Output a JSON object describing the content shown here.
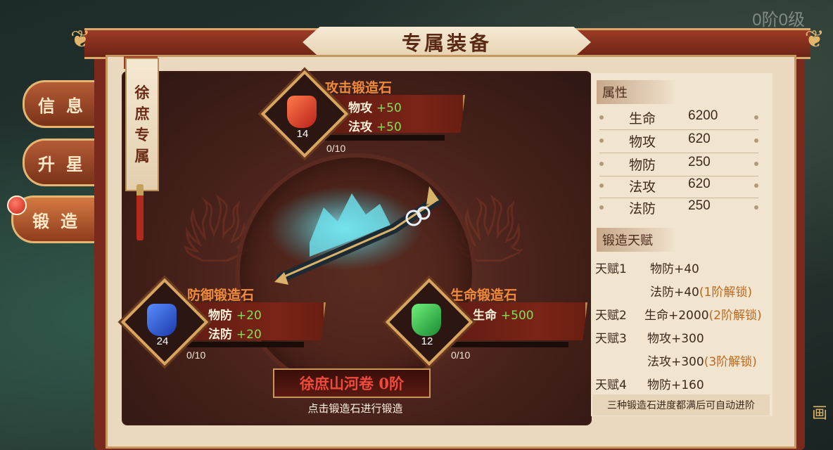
{
  "header": {
    "level": "0阶0级",
    "title": "专属装备"
  },
  "tabs": [
    {
      "label": "信息",
      "active": false
    },
    {
      "label": "升星",
      "active": false
    },
    {
      "label": "锻造",
      "active": true
    }
  ],
  "banner": {
    "text": [
      "徐",
      "庶",
      "专",
      "属"
    ]
  },
  "stones": {
    "attack": {
      "title": "攻击锻造石",
      "count": "14",
      "stat1_name": "物攻",
      "stat1_bonus": "+50",
      "stat2_name": "法攻",
      "stat2_bonus": "+50",
      "progress": "0/10",
      "color": "#d8432a"
    },
    "defense": {
      "title": "防御锻造石",
      "count": "24",
      "stat1_name": "物防",
      "stat1_bonus": "+20",
      "stat2_name": "法防",
      "stat2_bonus": "+20",
      "progress": "0/10",
      "color": "#2f5fd0"
    },
    "life": {
      "title": "生命锻造石",
      "count": "12",
      "stat1_name": "生命",
      "stat1_bonus": "+500",
      "progress": "0/10",
      "color": "#2fb34a"
    }
  },
  "equipment": {
    "name": "徐庶山河卷 0阶",
    "hint": "点击锻造石进行锻造"
  },
  "attributes": {
    "title": "属性",
    "rows": [
      {
        "name": "生命",
        "value": "6200"
      },
      {
        "name": "物攻",
        "value": "620"
      },
      {
        "name": "物防",
        "value": "250"
      },
      {
        "name": "法攻",
        "value": "620"
      },
      {
        "name": "法防",
        "value": "250"
      }
    ]
  },
  "talents": {
    "title": "锻造天赋",
    "t1_label": "天赋1",
    "t1_line1": "物防+40",
    "t1_line2": "法防+40",
    "t1_unlock": "(1阶解锁)",
    "t2_label": "天赋2",
    "t2_line1": "生命+2000",
    "t2_unlock": "(2阶解锁)",
    "t3_label": "天赋3",
    "t3_line1": "物攻+300",
    "t3_line2": "法攻+300",
    "t3_unlock": "(3阶解锁)",
    "t4_label": "天赋4",
    "t4_line1": "物防+160",
    "note": "三种锻造石进度都满后可自动进阶"
  },
  "side_fragment": "画"
}
